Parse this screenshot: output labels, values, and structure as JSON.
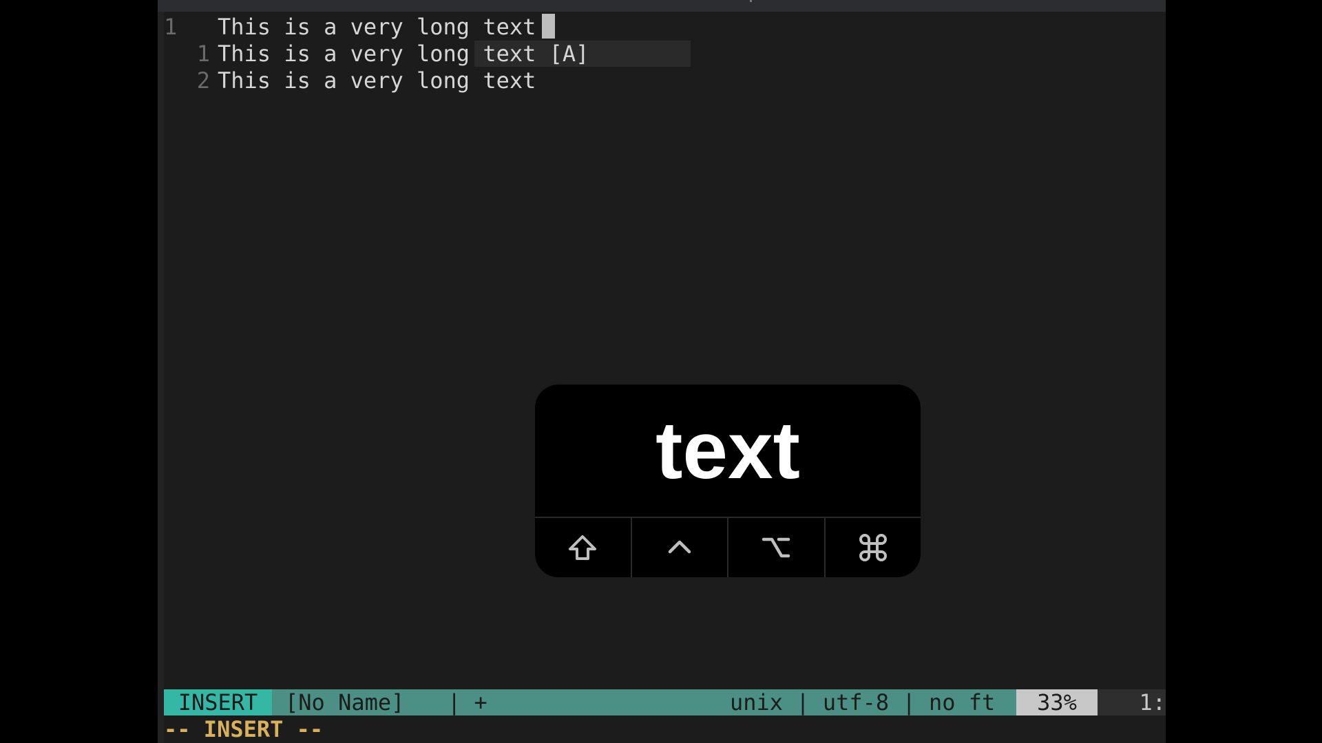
{
  "editor": {
    "lines": [
      {
        "number": "1",
        "text": "This is a very long text"
      },
      {
        "number": "1",
        "text": "This is a very long text [A]"
      },
      {
        "number": "2",
        "text": "This is a very long text"
      }
    ]
  },
  "statusline": {
    "mode": "INSERT",
    "buffer_name": "[No Name]",
    "modified": "| +",
    "file_info": "unix | utf-8 | no ft",
    "percent": "33%",
    "position": "1:"
  },
  "cmdline": {
    "message": "-- INSERT --"
  },
  "keycast": {
    "text": "text",
    "modifiers": [
      "shift-icon",
      "control-icon",
      "option-icon",
      "command-icon"
    ]
  },
  "colors": {
    "background": "#1c1c1c",
    "mode_accent": "#35b7a6",
    "statusline": "#4b8f85",
    "cmdline_text": "#d8b15a"
  }
}
